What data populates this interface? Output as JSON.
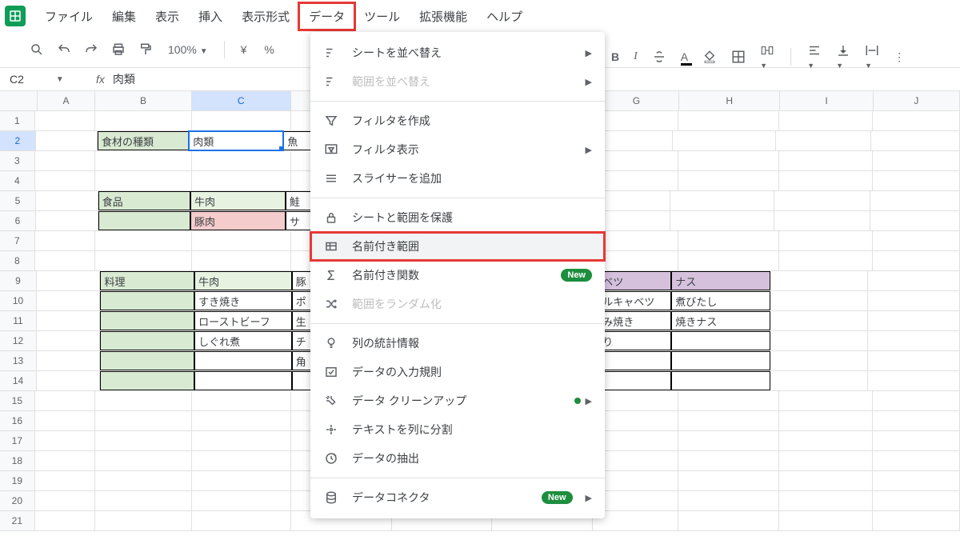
{
  "menubar": {
    "items": [
      "ファイル",
      "編集",
      "表示",
      "挿入",
      "表示形式",
      "データ",
      "ツール",
      "拡張機能",
      "ヘルプ"
    ],
    "highlighted_index": 5
  },
  "toolbar": {
    "zoom": "100%",
    "currency": "¥",
    "percent": "%"
  },
  "namebox": {
    "ref": "C2",
    "formula": "肉類"
  },
  "columns": [
    "A",
    "B",
    "C",
    "D",
    "E",
    "F",
    "G",
    "H",
    "I",
    "J"
  ],
  "col_classes": [
    "col-A",
    "col-B",
    "col-C",
    "col-D",
    "col-E",
    "col-F",
    "col-G",
    "col-H",
    "col-I",
    "col-J"
  ],
  "selected": {
    "row": 2,
    "col": "C"
  },
  "rows": [
    {
      "n": 1,
      "cells": [
        {
          "c": "col-A"
        },
        {
          "c": "col-B"
        },
        {
          "c": "col-C"
        },
        {
          "c": "col-D"
        },
        {
          "c": "col-E"
        },
        {
          "c": "col-F"
        },
        {
          "c": "col-G"
        },
        {
          "c": "col-H"
        },
        {
          "c": "col-I"
        },
        {
          "c": "col-J"
        }
      ]
    },
    {
      "n": 2,
      "cells": [
        {
          "c": "col-A"
        },
        {
          "c": "col-B",
          "t": "食材の種類",
          "cls": "bord bg-green-h"
        },
        {
          "c": "col-C",
          "t": "肉類",
          "cls": "bord selected-cell"
        },
        {
          "c": "col-D",
          "t": "魚",
          "cls": "bord"
        },
        {
          "c": "col-E"
        },
        {
          "c": "col-F"
        },
        {
          "c": "col-G"
        },
        {
          "c": "col-H"
        },
        {
          "c": "col-I"
        },
        {
          "c": "col-J"
        }
      ]
    },
    {
      "n": 3,
      "cells": [
        {
          "c": "col-A"
        },
        {
          "c": "col-B"
        },
        {
          "c": "col-C"
        },
        {
          "c": "col-D"
        },
        {
          "c": "col-E"
        },
        {
          "c": "col-F"
        },
        {
          "c": "col-G"
        },
        {
          "c": "col-H"
        },
        {
          "c": "col-I"
        },
        {
          "c": "col-J"
        }
      ]
    },
    {
      "n": 4,
      "cells": [
        {
          "c": "col-A"
        },
        {
          "c": "col-B"
        },
        {
          "c": "col-C"
        },
        {
          "c": "col-D"
        },
        {
          "c": "col-E"
        },
        {
          "c": "col-F"
        },
        {
          "c": "col-G"
        },
        {
          "c": "col-H"
        },
        {
          "c": "col-I"
        },
        {
          "c": "col-J"
        }
      ]
    },
    {
      "n": 5,
      "cells": [
        {
          "c": "col-A"
        },
        {
          "c": "col-B",
          "t": "食品",
          "cls": "bord bg-green-h"
        },
        {
          "c": "col-C",
          "t": "牛肉",
          "cls": "bord bg-green"
        },
        {
          "c": "col-D",
          "t": "鮭",
          "cls": "bord"
        },
        {
          "c": "col-E",
          "cls": "bord"
        },
        {
          "c": "col-F"
        },
        {
          "c": "col-G"
        },
        {
          "c": "col-H"
        },
        {
          "c": "col-I"
        },
        {
          "c": "col-J"
        }
      ]
    },
    {
      "n": 6,
      "cells": [
        {
          "c": "col-A"
        },
        {
          "c": "col-B",
          "cls": "bord bg-green-h"
        },
        {
          "c": "col-C",
          "t": "豚肉",
          "cls": "bord bg-pink"
        },
        {
          "c": "col-D",
          "t": "サ",
          "cls": "bord"
        },
        {
          "c": "col-E",
          "cls": "bord"
        },
        {
          "c": "col-F"
        },
        {
          "c": "col-G"
        },
        {
          "c": "col-H"
        },
        {
          "c": "col-I"
        },
        {
          "c": "col-J"
        }
      ]
    },
    {
      "n": 7,
      "cells": [
        {
          "c": "col-A"
        },
        {
          "c": "col-B"
        },
        {
          "c": "col-C"
        },
        {
          "c": "col-D"
        },
        {
          "c": "col-E"
        },
        {
          "c": "col-F"
        },
        {
          "c": "col-G"
        },
        {
          "c": "col-H"
        },
        {
          "c": "col-I"
        },
        {
          "c": "col-J"
        }
      ]
    },
    {
      "n": 8,
      "cells": [
        {
          "c": "col-A"
        },
        {
          "c": "col-B"
        },
        {
          "c": "col-C"
        },
        {
          "c": "col-D"
        },
        {
          "c": "col-E"
        },
        {
          "c": "col-F"
        },
        {
          "c": "col-G"
        },
        {
          "c": "col-H"
        },
        {
          "c": "col-I"
        },
        {
          "c": "col-J"
        }
      ]
    },
    {
      "n": 9,
      "cells": [
        {
          "c": "col-A"
        },
        {
          "c": "col-B",
          "t": "料理",
          "cls": "bord bg-green-h"
        },
        {
          "c": "col-C",
          "t": "牛肉",
          "cls": "bord bg-green"
        },
        {
          "c": "col-D",
          "t": "豚",
          "cls": "bord"
        },
        {
          "c": "col-E",
          "cls": "bord"
        },
        {
          "c": "col-F",
          "cls": "bord"
        },
        {
          "c": "col-G",
          "t": "ャベツ",
          "cls": "bord bg-purple"
        },
        {
          "c": "col-H",
          "t": "ナス",
          "cls": "bord bg-purple"
        },
        {
          "c": "col-I"
        },
        {
          "c": "col-J"
        }
      ]
    },
    {
      "n": 10,
      "cells": [
        {
          "c": "col-A"
        },
        {
          "c": "col-B",
          "cls": "bord bg-green-h"
        },
        {
          "c": "col-C",
          "t": "すき焼き",
          "cls": "bord"
        },
        {
          "c": "col-D",
          "t": "ポ",
          "cls": "bord"
        },
        {
          "c": "col-E",
          "cls": "bord"
        },
        {
          "c": "col-F",
          "cls": "bord"
        },
        {
          "c": "col-G",
          "t": "ールキャベツ",
          "cls": "bord"
        },
        {
          "c": "col-H",
          "t": "煮びたし",
          "cls": "bord"
        },
        {
          "c": "col-I"
        },
        {
          "c": "col-J"
        }
      ]
    },
    {
      "n": 11,
      "cells": [
        {
          "c": "col-A"
        },
        {
          "c": "col-B",
          "cls": "bord bg-green-h"
        },
        {
          "c": "col-C",
          "t": "ローストビーフ",
          "cls": "bord"
        },
        {
          "c": "col-D",
          "t": "生",
          "cls": "bord"
        },
        {
          "c": "col-E",
          "cls": "bord"
        },
        {
          "c": "col-F",
          "cls": "bord"
        },
        {
          "c": "col-G",
          "t": "好み焼き",
          "cls": "bord"
        },
        {
          "c": "col-H",
          "t": "焼きナス",
          "cls": "bord"
        },
        {
          "c": "col-I"
        },
        {
          "c": "col-J"
        }
      ]
    },
    {
      "n": 12,
      "cells": [
        {
          "c": "col-A"
        },
        {
          "c": "col-B",
          "cls": "bord bg-green-h"
        },
        {
          "c": "col-C",
          "t": "しぐれ煮",
          "cls": "bord"
        },
        {
          "c": "col-D",
          "t": "チ",
          "cls": "bord"
        },
        {
          "c": "col-E",
          "cls": "bord"
        },
        {
          "c": "col-F",
          "cls": "bord"
        },
        {
          "c": "col-G",
          "t": "切り",
          "cls": "bord"
        },
        {
          "c": "col-H",
          "cls": "bord"
        },
        {
          "c": "col-I"
        },
        {
          "c": "col-J"
        }
      ]
    },
    {
      "n": 13,
      "cells": [
        {
          "c": "col-A"
        },
        {
          "c": "col-B",
          "cls": "bord bg-green-h"
        },
        {
          "c": "col-C",
          "cls": "bord"
        },
        {
          "c": "col-D",
          "t": "角",
          "cls": "bord"
        },
        {
          "c": "col-E",
          "cls": "bord"
        },
        {
          "c": "col-F",
          "cls": "bord"
        },
        {
          "c": "col-G",
          "cls": "bord"
        },
        {
          "c": "col-H",
          "cls": "bord"
        },
        {
          "c": "col-I"
        },
        {
          "c": "col-J"
        }
      ]
    },
    {
      "n": 14,
      "cells": [
        {
          "c": "col-A"
        },
        {
          "c": "col-B",
          "cls": "bord bg-green-h"
        },
        {
          "c": "col-C",
          "cls": "bord"
        },
        {
          "c": "col-D",
          "cls": "bord"
        },
        {
          "c": "col-E",
          "cls": "bord"
        },
        {
          "c": "col-F",
          "cls": "bord"
        },
        {
          "c": "col-G",
          "cls": "bord"
        },
        {
          "c": "col-H",
          "cls": "bord"
        },
        {
          "c": "col-I"
        },
        {
          "c": "col-J"
        }
      ]
    },
    {
      "n": 15,
      "cells": [
        {
          "c": "col-A"
        },
        {
          "c": "col-B"
        },
        {
          "c": "col-C"
        },
        {
          "c": "col-D"
        },
        {
          "c": "col-E"
        },
        {
          "c": "col-F"
        },
        {
          "c": "col-G"
        },
        {
          "c": "col-H"
        },
        {
          "c": "col-I"
        },
        {
          "c": "col-J"
        }
      ]
    },
    {
      "n": 16,
      "cells": [
        {
          "c": "col-A"
        },
        {
          "c": "col-B"
        },
        {
          "c": "col-C"
        },
        {
          "c": "col-D"
        },
        {
          "c": "col-E"
        },
        {
          "c": "col-F"
        },
        {
          "c": "col-G"
        },
        {
          "c": "col-H"
        },
        {
          "c": "col-I"
        },
        {
          "c": "col-J"
        }
      ]
    },
    {
      "n": 17,
      "cells": [
        {
          "c": "col-A"
        },
        {
          "c": "col-B"
        },
        {
          "c": "col-C"
        },
        {
          "c": "col-D"
        },
        {
          "c": "col-E"
        },
        {
          "c": "col-F"
        },
        {
          "c": "col-G"
        },
        {
          "c": "col-H"
        },
        {
          "c": "col-I"
        },
        {
          "c": "col-J"
        }
      ]
    },
    {
      "n": 18,
      "cells": [
        {
          "c": "col-A"
        },
        {
          "c": "col-B"
        },
        {
          "c": "col-C"
        },
        {
          "c": "col-D"
        },
        {
          "c": "col-E"
        },
        {
          "c": "col-F"
        },
        {
          "c": "col-G"
        },
        {
          "c": "col-H"
        },
        {
          "c": "col-I"
        },
        {
          "c": "col-J"
        }
      ]
    },
    {
      "n": 19,
      "cells": [
        {
          "c": "col-A"
        },
        {
          "c": "col-B"
        },
        {
          "c": "col-C"
        },
        {
          "c": "col-D"
        },
        {
          "c": "col-E"
        },
        {
          "c": "col-F"
        },
        {
          "c": "col-G"
        },
        {
          "c": "col-H"
        },
        {
          "c": "col-I"
        },
        {
          "c": "col-J"
        }
      ]
    },
    {
      "n": 20,
      "cells": [
        {
          "c": "col-A"
        },
        {
          "c": "col-B"
        },
        {
          "c": "col-C"
        },
        {
          "c": "col-D"
        },
        {
          "c": "col-E"
        },
        {
          "c": "col-F"
        },
        {
          "c": "col-G"
        },
        {
          "c": "col-H"
        },
        {
          "c": "col-I"
        },
        {
          "c": "col-J"
        }
      ]
    },
    {
      "n": 21,
      "cells": [
        {
          "c": "col-A"
        },
        {
          "c": "col-B"
        },
        {
          "c": "col-C"
        },
        {
          "c": "col-D"
        },
        {
          "c": "col-E"
        },
        {
          "c": "col-F"
        },
        {
          "c": "col-G"
        },
        {
          "c": "col-H"
        },
        {
          "c": "col-I"
        },
        {
          "c": "col-J"
        }
      ]
    }
  ],
  "dropdown": {
    "groups": [
      [
        {
          "icon": "sort",
          "label": "シートを並べ替え",
          "arrow": true
        },
        {
          "icon": "sort",
          "label": "範囲を並べ替え",
          "arrow": true,
          "disabled": true
        }
      ],
      [
        {
          "icon": "filter",
          "label": "フィルタを作成"
        },
        {
          "icon": "filter-view",
          "label": "フィルタ表示",
          "arrow": true
        },
        {
          "icon": "slicer",
          "label": "スライサーを追加"
        }
      ],
      [
        {
          "icon": "lock",
          "label": "シートと範囲を保護"
        },
        {
          "icon": "named-range",
          "label": "名前付き範囲",
          "highlighted": true
        },
        {
          "icon": "sigma",
          "label": "名前付き関数",
          "badge": "New"
        },
        {
          "icon": "shuffle",
          "label": "範囲をランダム化",
          "disabled": true
        }
      ],
      [
        {
          "icon": "bulb",
          "label": "列の統計情報"
        },
        {
          "icon": "validation",
          "label": "データの入力規則"
        },
        {
          "icon": "cleanup",
          "label": "データ クリーンアップ",
          "dotarrow": true
        },
        {
          "icon": "split",
          "label": "テキストを列に分割"
        },
        {
          "icon": "extract",
          "label": "データの抽出"
        }
      ],
      [
        {
          "icon": "connector",
          "label": "データコネクタ",
          "badge": "New",
          "arrow": true
        }
      ]
    ]
  },
  "toolbar_right": {
    "bold": "B",
    "italic": "I"
  }
}
